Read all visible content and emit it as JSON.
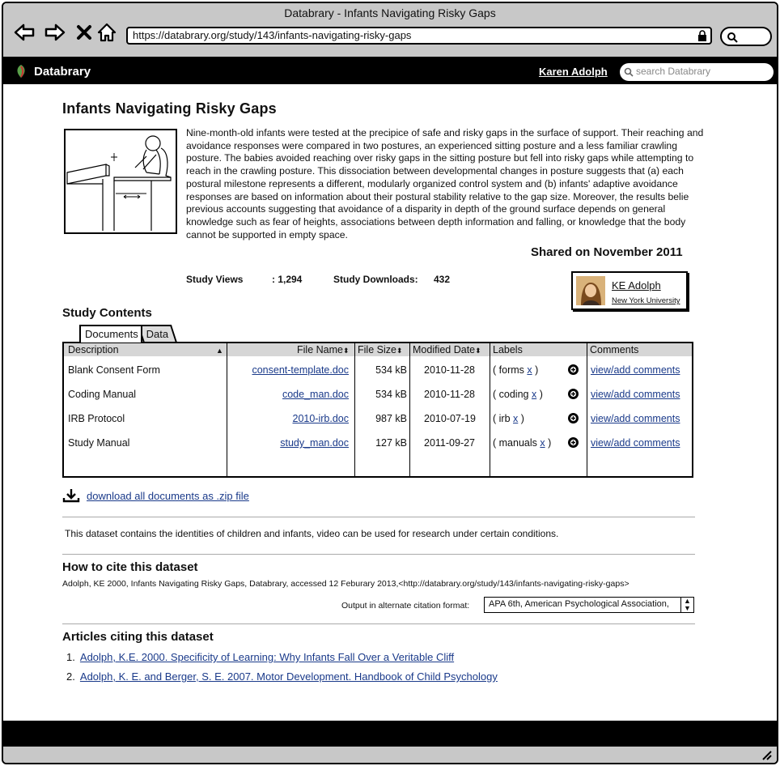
{
  "window": {
    "title": "Databrary - Infants Navigating Risky Gaps",
    "url": "https://databrary.org/study/143/infants-navigating-risky-gaps"
  },
  "nav": {
    "logo_text": "Databrary",
    "user": "Karen Adolph",
    "search_placeholder": "search Databrary"
  },
  "study": {
    "title": "Infants Navigating Risky Gaps",
    "abstract": "Nine-month-old infants were tested at the precipice of safe and risky gaps in the surface of support. Their reaching and avoidance responses were compared in two postures, an experienced sitting posture and a less familiar crawling posture. The babies avoided reaching over risky gaps in the sitting posture but fell into risky gaps while attempting to reach in the crawling posture. This dissociation between developmental changes in posture suggests that (a) each postural milestone represents a different, modularly organized control system and (b) infants' adaptive avoidance responses are based on information about their postural stability relative to the gap size. Moreover, the results belie previous accounts suggesting that avoidance of a disparity in depth of the ground surface depends on general knowledge such as fear of heights, associations between depth information and falling, or knowledge that the body cannot be supported in empty space.",
    "shared": "Shared on November 2011",
    "views_label": "Study Views",
    "views_value": ": 1,294",
    "downloads_label": "Study Downloads:",
    "downloads_value": "432",
    "author_name": "KE Adolph",
    "author_institution": "New York University"
  },
  "contents": {
    "title": "Study Contents",
    "tabs": [
      "Documents",
      "Data"
    ],
    "headers": {
      "description": "Description",
      "file_name": "File Name",
      "file_size": "File Size",
      "modified": "Modified Date",
      "labels": "Labels",
      "comments": "Comments"
    },
    "rows": [
      {
        "description": "Blank Consent Form",
        "file": "consent-template.doc",
        "size": "534 kB",
        "date": "2010-11-28",
        "label": "forms",
        "comments": "view/add comments"
      },
      {
        "description": "Coding Manual",
        "file": "code_man.doc",
        "size": "534 kB",
        "date": "2010-11-28",
        "label": "coding",
        "comments": "view/add comments"
      },
      {
        "description": "IRB Protocol",
        "file": "2010-irb.doc",
        "size": "987 kB",
        "date": "2010-07-19",
        "label": "irb",
        "comments": "view/add comments"
      },
      {
        "description": "Study Manual",
        "file": "study_man.doc",
        "size": "127 kB",
        "date": "2011-09-27",
        "label": "manuals",
        "comments": "view/add comments"
      }
    ],
    "download_all": "download all documents as .zip file"
  },
  "notice": "This dataset contains the identities of children and infants, video can be used for research under certain conditions.",
  "citation": {
    "title": "How to cite this dataset",
    "text": "Adolph, KE 2000, Infants Navigating Risky Gaps, Databrary, accessed 12 Feburary 2013,<http://databrary.org/study/143/infants-navigating-risky-gaps>",
    "format_label": "Output in alternate citation format:",
    "format_value": "APA 6th, American Psychological Association,"
  },
  "articles": {
    "title": "Articles citing this dataset",
    "items": [
      {
        "num": "1.",
        "text": "Adolph, K.E. 2000. Specificity of Learning: Why Infants Fall Over a Veritable Cliff"
      },
      {
        "num": "2.",
        "text": "Adolph, K. E. and Berger, S. E. 2007. Motor Development. Handbook of Child Psychology"
      }
    ]
  }
}
